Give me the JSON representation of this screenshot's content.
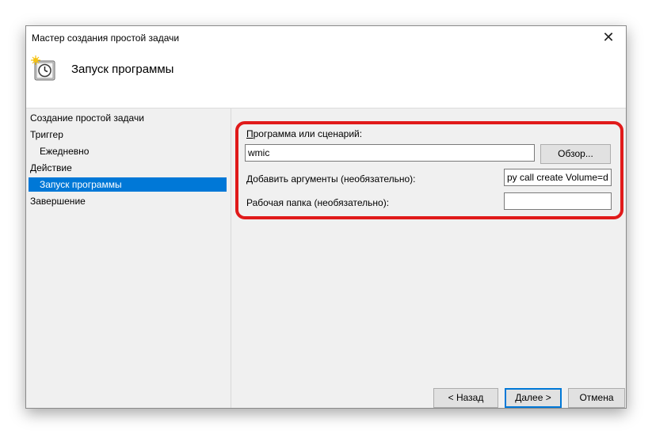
{
  "window": {
    "title": "Мастер создания простой задачи",
    "close_glyph": "✕"
  },
  "header": {
    "icon": "task-scheduler-clock-icon",
    "title": "Запуск программы"
  },
  "sidebar": {
    "items": [
      {
        "label": "Создание простой задачи",
        "level": 0,
        "selected": false
      },
      {
        "label": "Триггер",
        "level": 0,
        "selected": false
      },
      {
        "label": "Ежедневно",
        "level": 1,
        "selected": false
      },
      {
        "label": "Действие",
        "level": 0,
        "selected": false
      },
      {
        "label": "Запуск программы",
        "level": 1,
        "selected": true
      },
      {
        "label": "Завершение",
        "level": 0,
        "selected": false
      }
    ],
    "selected_color": "#0078d7"
  },
  "form": {
    "program": {
      "label": "Программа или сценарий:",
      "value": "wmic"
    },
    "browse_button": "Обзор...",
    "arguments": {
      "label": "Добавить аргументы (необязательно):",
      "value": "py call create Volume=d"
    },
    "workdir": {
      "label": "Рабочая папка (необязательно):",
      "value": ""
    },
    "highlight_color": "#e01a1a"
  },
  "footer": {
    "back": "< Назад",
    "next": "Далее >",
    "cancel": "Отмена"
  }
}
